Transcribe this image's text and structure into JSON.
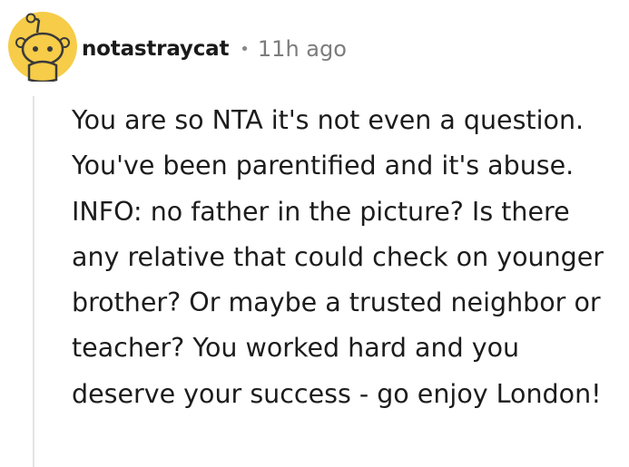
{
  "comment": {
    "author": "notastraycat",
    "separator": "•",
    "timestamp": "11h ago",
    "avatar_icon": "snoo-avatar-icon",
    "avatar_bg_color": "#f6cc48",
    "body": "You are so NTA it's not even a question. You've been parentified and it's abuse. INFO: no father in the picture? Is there any relative that could check on younger brother? Or maybe a trusted neighbor or teacher? You worked hard and you deserve your success - go enjoy London!"
  }
}
